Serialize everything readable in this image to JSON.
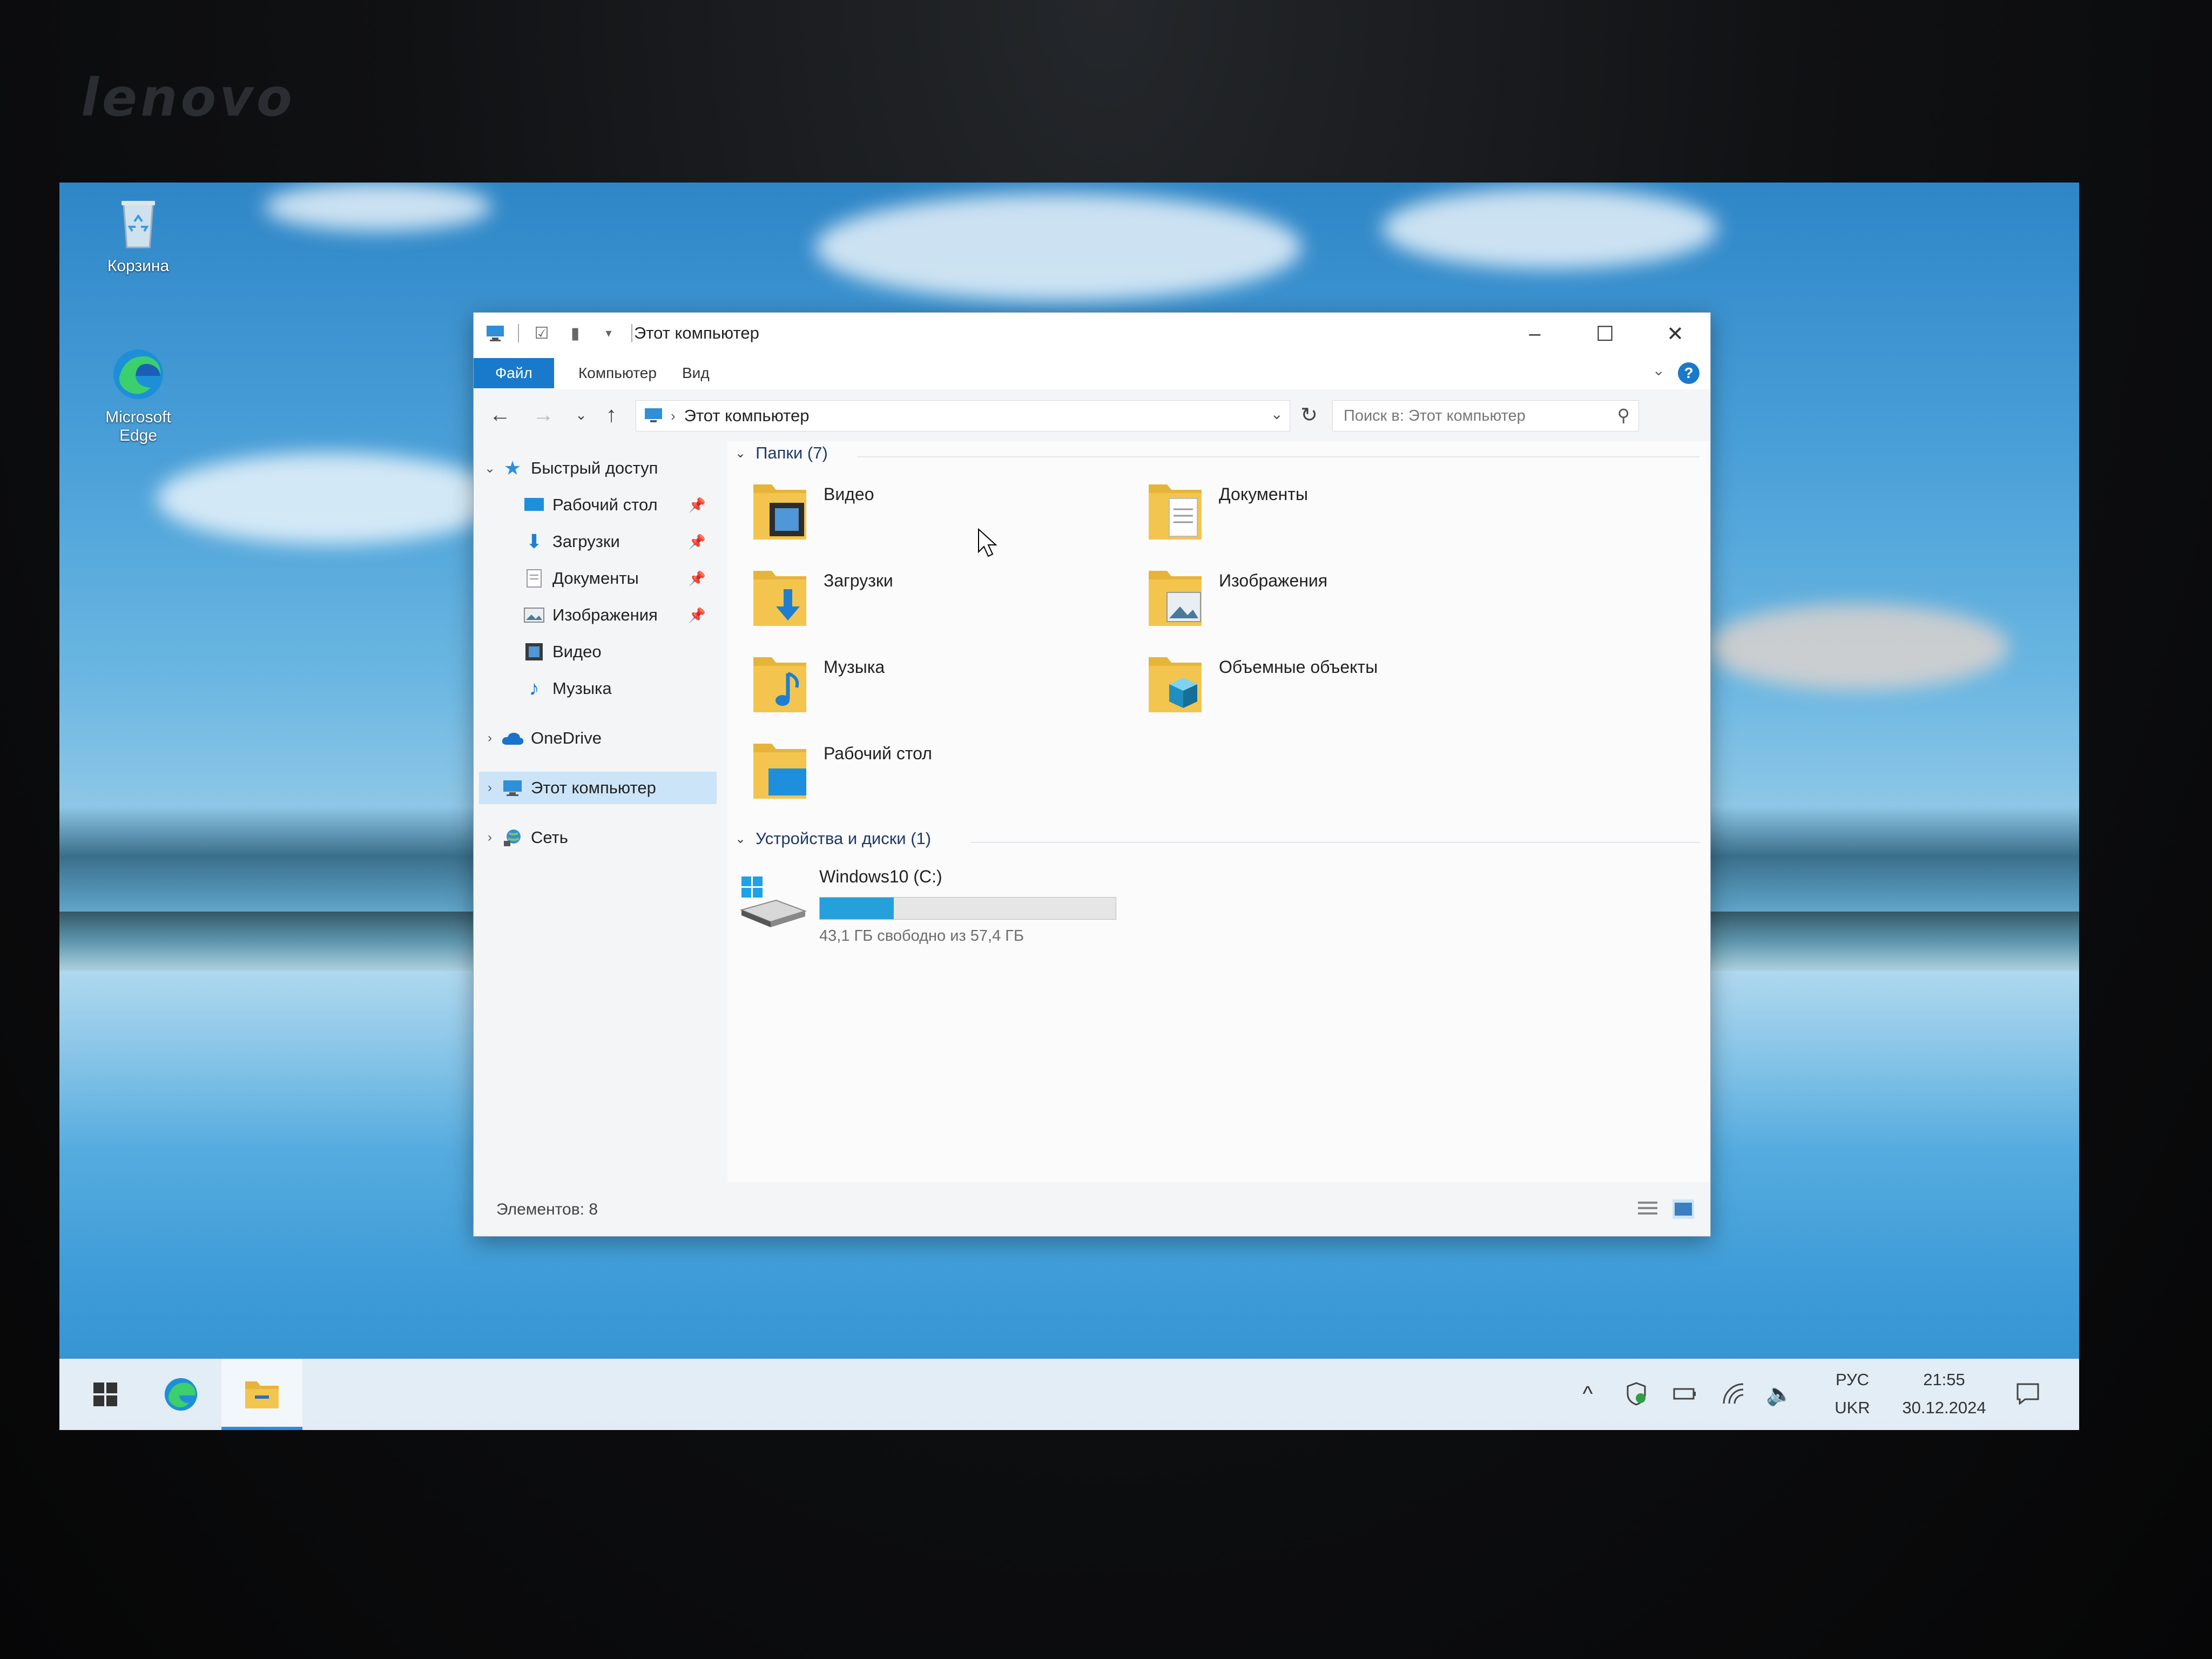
{
  "bezel": {
    "brand": "lenovo"
  },
  "desktop": {
    "icons": [
      {
        "label": "Корзина",
        "icon": "recycle-bin-icon"
      },
      {
        "label": "Microsoft Edge",
        "icon": "edge-icon"
      }
    ]
  },
  "window": {
    "title": "Этот компьютер",
    "ribbon_tabs": [
      "Файл",
      "Компьютер",
      "Вид"
    ],
    "help_label": "?",
    "address": {
      "path": "Этот компьютер"
    },
    "search": {
      "placeholder": "Поиск в: Этот компьютер",
      "value": ""
    },
    "sidebar": {
      "quick_access": "Быстрый доступ",
      "pinned": [
        "Рабочий стол",
        "Загрузки",
        "Документы",
        "Изображения"
      ],
      "unpinned": [
        "Видео",
        "Музыка"
      ],
      "onedrive": "OneDrive",
      "this_pc": "Этот компьютер",
      "network": "Сеть"
    },
    "folders_group": "Папки (7)",
    "folders": [
      {
        "label": "Видео",
        "icon": "video-folder-icon"
      },
      {
        "label": "Документы",
        "icon": "documents-folder-icon"
      },
      {
        "label": "Загрузки",
        "icon": "downloads-folder-icon"
      },
      {
        "label": "Изображения",
        "icon": "pictures-folder-icon"
      },
      {
        "label": "Музыка",
        "icon": "music-folder-icon"
      },
      {
        "label": "Объемные объекты",
        "icon": "3d-objects-folder-icon"
      },
      {
        "label": "Рабочий стол",
        "icon": "desktop-folder-icon"
      }
    ],
    "devices_group": "Устройства и диски (1)",
    "drive": {
      "label": "Windows10 (C:)",
      "free_text": "43,1 ГБ свободно из 57,4 ГБ",
      "used_fraction": 0.25
    },
    "status": "Элементов: 8"
  },
  "taskbar": {
    "lang_top": "РУС",
    "lang_bottom": "UKR",
    "time": "21:55",
    "date": "30.12.2024"
  },
  "colors": {
    "accent": "#1979ca",
    "drive_fill": "#26a0da",
    "folder_yellow": "#f3c54f"
  }
}
